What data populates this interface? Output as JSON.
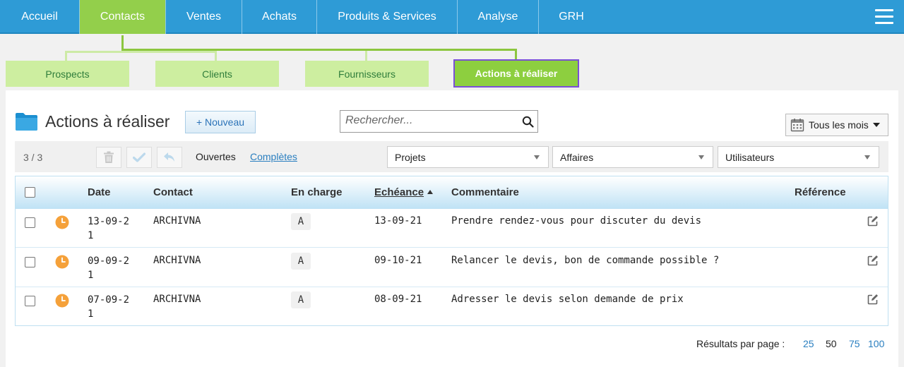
{
  "nav": {
    "items": [
      {
        "label": "Accueil",
        "active": false
      },
      {
        "label": "Contacts",
        "active": true
      },
      {
        "label": "Ventes",
        "active": false
      },
      {
        "label": "Achats",
        "active": false
      },
      {
        "label": "Produits & Services",
        "active": false
      },
      {
        "label": "Analyse",
        "active": false
      },
      {
        "label": "GRH",
        "active": false
      }
    ]
  },
  "subtabs": [
    {
      "label": "Prospects",
      "active": false
    },
    {
      "label": "Clients",
      "active": false
    },
    {
      "label": "Fournisseurs",
      "active": false
    },
    {
      "label": "Actions à réaliser",
      "active": true
    }
  ],
  "page": {
    "title": "Actions à réaliser",
    "new_button": "+ Nouveau",
    "search_placeholder": "Rechercher...",
    "month_filter": "Tous les mois"
  },
  "toolbar": {
    "count": "3 / 3",
    "filter_open": "Ouvertes",
    "filter_complete": "Complètes",
    "selects": [
      "Projets",
      "Affaires",
      "Utilisateurs"
    ]
  },
  "table": {
    "headers": {
      "date": "Date",
      "contact": "Contact",
      "en_charge": "En charge",
      "echeance": "Echéance",
      "commentaire": "Commentaire",
      "reference": "Référence"
    },
    "rows": [
      {
        "date": "13-09-21",
        "contact": "ARCHIVNA",
        "en_charge": "A",
        "echeance": "13-09-21",
        "commentaire": "Prendre rendez-vous pour discuter du devis"
      },
      {
        "date": "09-09-21",
        "contact": "ARCHIVNA",
        "en_charge": "A",
        "echeance": "09-10-21",
        "commentaire": "Relancer le devis, bon de commande possible ?"
      },
      {
        "date": "07-09-21",
        "contact": "ARCHIVNA",
        "en_charge": "A",
        "echeance": "08-09-21",
        "commentaire": "Adresser le devis selon demande de prix"
      }
    ]
  },
  "pagination": {
    "label": "Résultats par page :",
    "options": [
      "25",
      "50",
      "75",
      "100"
    ],
    "current": "50"
  },
  "colors": {
    "nav_blue": "#2e9bd6",
    "nav_active_green": "#93cf4b",
    "subtab_light_green": "#cdeea0",
    "subtab_active_green": "#8dcf3f",
    "active_outline": "#7a4fd6",
    "clock_orange": "#f5a13a",
    "link_blue": "#2a7fc0"
  },
  "icons": {
    "menu": "hamburger-icon",
    "folder": "folder-icon",
    "search": "search-icon",
    "calendar": "calendar-icon",
    "delete": "trash-icon",
    "complete": "check-icon",
    "reopen": "undo-arrow-icon",
    "status": "clock-icon",
    "edit": "edit-icon"
  }
}
